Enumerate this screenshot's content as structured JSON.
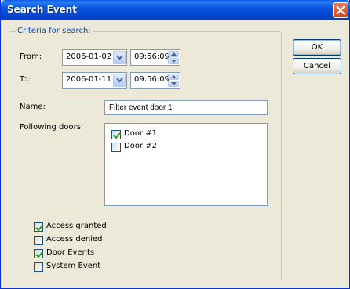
{
  "window": {
    "title": "Search Event"
  },
  "criteria": {
    "legend": "Criteria for search:",
    "from": {
      "label": "From:",
      "date": "2006-01-02",
      "time": "09:56:09"
    },
    "to": {
      "label": "To:",
      "date": "2006-01-11",
      "time": "09:56:09"
    },
    "name": {
      "label": "Name:",
      "value": "Filter event door 1"
    },
    "doors": {
      "label": "Following doors:",
      "items": [
        {
          "label": "Door #1",
          "checked": true
        },
        {
          "label": "Door #2",
          "checked": false
        }
      ]
    },
    "events": [
      {
        "label": "Access granted",
        "checked": true
      },
      {
        "label": "Access denied",
        "checked": false
      },
      {
        "label": "Door Events",
        "checked": true
      },
      {
        "label": "System Event",
        "checked": false
      }
    ]
  },
  "buttons": {
    "ok": "OK",
    "cancel": "Cancel"
  }
}
